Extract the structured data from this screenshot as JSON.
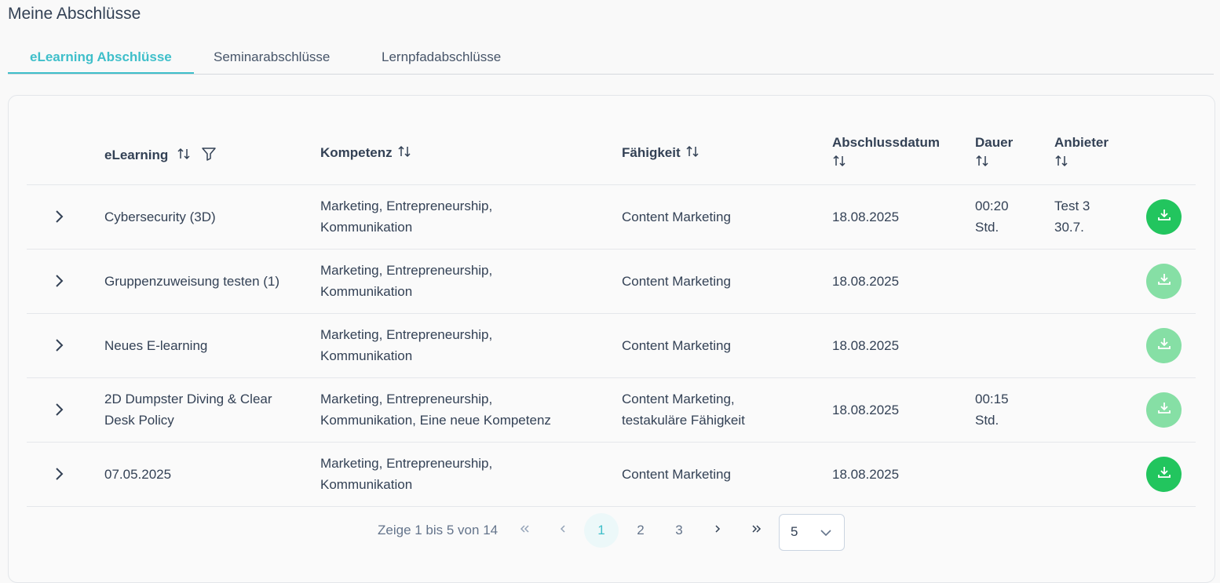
{
  "page": {
    "title": "Meine Abschlüsse"
  },
  "tabs": [
    {
      "label": "eLearning Abschlüsse",
      "active": true
    },
    {
      "label": "Seminarabschlüsse",
      "active": false
    },
    {
      "label": "Lernpfadabschlüsse",
      "active": false
    }
  ],
  "table": {
    "columns": {
      "elearning": "eLearning",
      "kompetenz": "Kompetenz",
      "faehigkeit": "Fähigkeit",
      "abschlussdatum": "Abschlussdatum",
      "dauer": "Dauer",
      "anbieter": "Anbieter"
    },
    "rows": [
      {
        "elearning": [
          "Cybersecurity (3D)"
        ],
        "kompetenz": [
          "Marketing, Entrepreneurship,",
          "Kommunikation"
        ],
        "faehigkeit": [
          "Content Marketing"
        ],
        "datum": "18.08.2025",
        "dauer": [
          "00:20",
          "Std."
        ],
        "anbieter": [
          "Test 3",
          "30.7."
        ],
        "download_enabled": true
      },
      {
        "elearning": [
          "Gruppenzuweisung testen (1)"
        ],
        "kompetenz": [
          "Marketing, Entrepreneurship,",
          "Kommunikation"
        ],
        "faehigkeit": [
          "Content Marketing"
        ],
        "datum": "18.08.2025",
        "dauer": [],
        "anbieter": [],
        "download_enabled": false
      },
      {
        "elearning": [
          "Neues E-learning"
        ],
        "kompetenz": [
          "Marketing, Entrepreneurship,",
          "Kommunikation"
        ],
        "faehigkeit": [
          "Content Marketing"
        ],
        "datum": "18.08.2025",
        "dauer": [],
        "anbieter": [],
        "download_enabled": false
      },
      {
        "elearning": [
          "2D Dumpster Diving & Clear",
          "Desk Policy"
        ],
        "kompetenz": [
          "Marketing, Entrepreneurship,",
          "Kommunikation, Eine neue Kompetenz"
        ],
        "faehigkeit": [
          "Content Marketing,",
          "testakuläre Fähigkeit"
        ],
        "datum": "18.08.2025",
        "dauer": [
          "00:15",
          "Std."
        ],
        "anbieter": [],
        "download_enabled": false
      },
      {
        "elearning": [
          "07.05.2025"
        ],
        "kompetenz": [
          "Marketing, Entrepreneurship,",
          "Kommunikation"
        ],
        "faehigkeit": [
          "Content Marketing"
        ],
        "datum": "18.08.2025",
        "dauer": [],
        "anbieter": [],
        "download_enabled": true
      }
    ]
  },
  "pagination": {
    "summary": "Zeige 1 bis 5 von 14",
    "pages": [
      "1",
      "2",
      "3"
    ],
    "current_page": "1",
    "page_size": "5"
  },
  "colors": {
    "accent": "#3fbfca",
    "download_active": "#22c55e",
    "download_disabled": "#86dfa5"
  },
  "icons": [
    "sort-icon",
    "filter-icon",
    "chevron-right-icon",
    "download-icon",
    "first-page-icon",
    "previous-page-icon",
    "next-page-icon",
    "last-page-icon",
    "chevron-down-icon"
  ]
}
